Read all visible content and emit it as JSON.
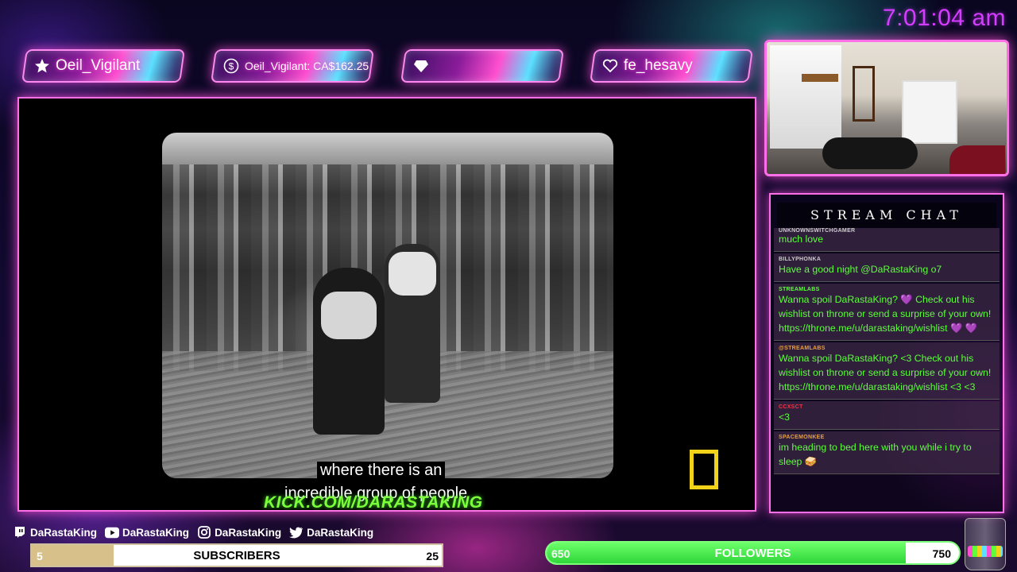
{
  "clock": "7:01:04 am",
  "alerts": [
    {
      "icon": "star-icon",
      "label": "Oeil_Vigilant"
    },
    {
      "icon": "dollar-icon",
      "label": "Oeil_Vigilant: CA$162.25"
    },
    {
      "icon": "diamond-icon",
      "label": ""
    },
    {
      "icon": "heart-icon",
      "label": "fe_hesavy"
    }
  ],
  "video": {
    "subtitle_line1": "where there is an",
    "subtitle_line2": "incredible group of people",
    "watermark": "KICK.COM/DARASTAKING"
  },
  "chat": {
    "title": "STREAM CHAT",
    "messages": [
      {
        "name": "UNKNOWNSWITCHGAMER",
        "name_color": "#cccccc",
        "text": "much love"
      },
      {
        "name": "BILLYPHONKA",
        "name_color": "#cccccc",
        "text": "Have a good night @DaRastaKing o7"
      },
      {
        "name": "STREAMLABS",
        "name_color": "#5cff3a",
        "text": "Wanna spoil DaRastaKing? 💜 Check out his wishlist on throne or send a surprise of your own! https://throne.me/u/darastaking/wishlist 💜 💜"
      },
      {
        "name": "@STREAMLABS",
        "name_color": "#e8a040",
        "text": "Wanna spoil DaRastaKing? <3 Check out his wishlist on throne or send a surprise of your own! https://throne.me/u/darastaking/wishlist <3 <3"
      },
      {
        "name": "CCXSCT",
        "name_color": "#ff3040",
        "text": "<3"
      },
      {
        "name": "SPACEMONKEE",
        "name_color": "#e8a040",
        "text": "im heading to bed here with you while i try to sleep 🥪"
      }
    ]
  },
  "social": [
    {
      "icon": "twitch-icon",
      "label": "DaRastaKing"
    },
    {
      "icon": "youtube-icon",
      "label": "DaRastaKing"
    },
    {
      "icon": "instagram-icon",
      "label": "DaRastaKing"
    },
    {
      "icon": "twitter-icon",
      "label": "DaRastaKing"
    }
  ],
  "subscribers": {
    "current": "5",
    "label": "SUBSCRIBERS",
    "goal": "25",
    "progress": 0.2
  },
  "followers": {
    "current": "650",
    "label": "FOLLOWERS",
    "goal": "750",
    "progress": 0.87
  }
}
